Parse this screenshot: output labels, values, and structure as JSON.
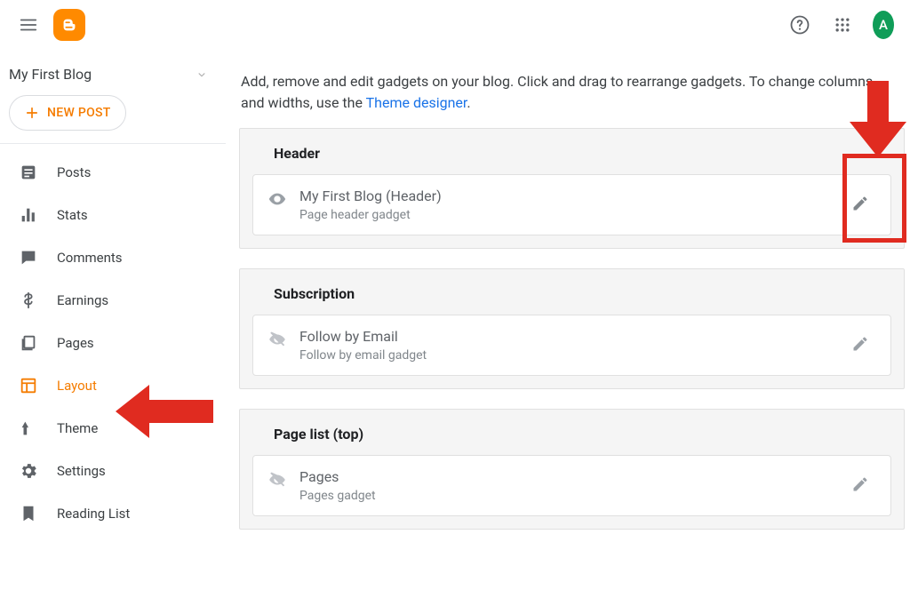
{
  "header": {
    "avatar_letter": "A"
  },
  "sidebar": {
    "blog_title": "My First Blog",
    "new_post_label": "NEW POST",
    "items": [
      {
        "label": "Posts"
      },
      {
        "label": "Stats"
      },
      {
        "label": "Comments"
      },
      {
        "label": "Earnings"
      },
      {
        "label": "Pages"
      },
      {
        "label": "Layout"
      },
      {
        "label": "Theme"
      },
      {
        "label": "Settings"
      },
      {
        "label": "Reading List"
      }
    ]
  },
  "main": {
    "intro_text": "Add, remove and edit gadgets on your blog. Click and drag to rearrange gadgets. To change columns and widths, use the ",
    "intro_link": "Theme designer",
    "intro_end": ".",
    "sections": [
      {
        "title": "Header",
        "cards": [
          {
            "title": "My First Blog (Header)",
            "subtitle": "Page header gadget",
            "visible": true
          }
        ]
      },
      {
        "title": "Subscription",
        "cards": [
          {
            "title": "Follow by Email",
            "subtitle": "Follow by email gadget",
            "visible": false
          }
        ]
      },
      {
        "title": "Page list (top)",
        "cards": [
          {
            "title": "Pages",
            "subtitle": "Pages gadget",
            "visible": false
          }
        ]
      }
    ]
  }
}
